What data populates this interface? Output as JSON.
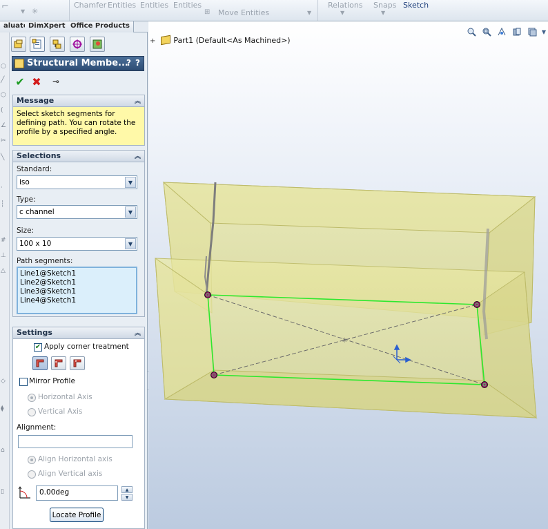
{
  "ribbon": {
    "items": [
      "Chamfer",
      "Entities",
      "Entities",
      "Entities",
      "Move Entities",
      "Relations",
      "Snaps",
      "Sketch"
    ],
    "active": "Sketch"
  },
  "command_tabs": [
    "aluate",
    "DimXpert",
    "Office Products"
  ],
  "property_manager": {
    "title": "Structural Membe...",
    "help_glyph_1": "?",
    "help_glyph_2": "?",
    "message": {
      "header": "Message",
      "text": "Select sketch segments for defining path. You can rotate the profile by a specified angle."
    },
    "selections": {
      "header": "Selections",
      "standard_label": "Standard:",
      "standard_value": "iso",
      "type_label": "Type:",
      "type_value": "c channel",
      "size_label": "Size:",
      "size_value": "100 x 10",
      "path_label": "Path segments:",
      "path_segments": [
        "Line1@Sketch1",
        "Line2@Sketch1",
        "Line3@Sketch1",
        "Line4@Sketch1"
      ]
    },
    "settings": {
      "header": "Settings",
      "apply_corner": "Apply corner treatment",
      "apply_corner_checked": true,
      "mirror_profile": "Mirror Profile",
      "mirror_checked": false,
      "horizontal_axis": "Horizontal Axis",
      "vertical_axis": "Vertical Axis",
      "alignment_label": "Alignment:",
      "alignment_value": "",
      "align_horizontal": "Align Horizontal axis",
      "align_vertical": "Align Vertical axis",
      "angle_value": "0.00deg",
      "locate_profile": "Locate Profile"
    }
  },
  "viewport": {
    "tree_root": "Part1  (Default<As Machined>)",
    "colors": {
      "frame_fill": "#dede8a",
      "frame_edge": "#b9b95a",
      "path_line": "#2ee82e",
      "endpoint": "#a0106a"
    }
  }
}
